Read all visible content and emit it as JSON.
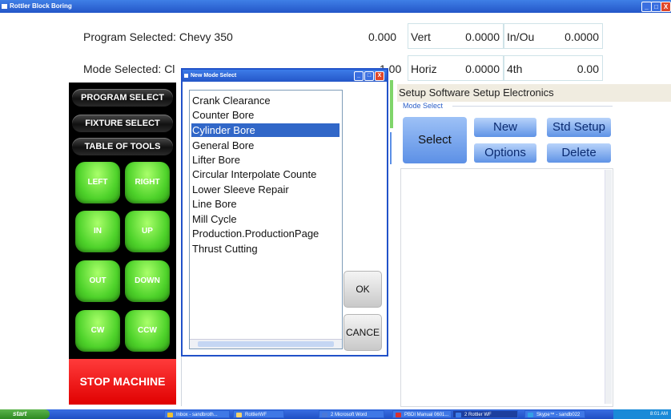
{
  "window": {
    "title": "Rottler Block Boring",
    "min_label": "_",
    "max_label": "□",
    "close_label": "X"
  },
  "header": {
    "program_selected_label": "Program Selected:",
    "program_selected_value": "Chevy 350",
    "mode_selected_label": "Mode Selected:",
    "mode_selected_value": "Cl",
    "readouts": [
      {
        "value": "0.000",
        "axis": "Vert",
        "axis_value": "0.0000",
        "axis2": "In/Ou",
        "axis2_value": "0.0000"
      },
      {
        "value": "1.00",
        "axis": "Horiz",
        "axis_value": "0.0000",
        "axis2": "4th",
        "axis2_value": "0.00"
      }
    ]
  },
  "left_panel": {
    "program_select": "PROGRAM SELECT",
    "fixture_select": "FIXTURE SELECT",
    "table_of_tools": "TABLE OF TOOLS",
    "jog_buttons": [
      "LEFT",
      "RIGHT",
      "IN",
      "UP",
      "OUT",
      "DOWN",
      "CW",
      "CCW"
    ],
    "stop": "STOP MACHINE",
    "colors": {
      "jog": "#4fd32b",
      "stop": "#e00000"
    }
  },
  "right_panel": {
    "tabs_text": "Setup Software  Setup Electronics",
    "mode_select_label": "Mode Select",
    "select": "Select",
    "new": "New",
    "std_setup": "Std Setup",
    "options": "Options",
    "delete": "Delete"
  },
  "dialog": {
    "title": "New Mode Select",
    "min_label": "_",
    "max_label": "□",
    "close_label": "X",
    "items": [
      "Crank Clearance",
      "Counter Bore",
      "Cylinder Bore",
      "General Bore",
      "Lifter Bore",
      "Circular Interpolate Counte",
      "Lower Sleeve Repair",
      "Line Bore",
      "Mill Cycle",
      "Production.ProductionPage",
      "Thrust Cutting"
    ],
    "selected_index": 2,
    "ok": "OK",
    "cancel": "CANCE",
    "accent": "#2152c9"
  },
  "taskbar": {
    "start": "start",
    "items": [
      {
        "label": "Inbox - sandbroth...",
        "icon": "#f0c030"
      },
      {
        "label": "RottlerWF",
        "icon": "#f7d26b"
      },
      {
        "label": "2 Microsoft Word",
        "icon": "#4a78d8"
      },
      {
        "label": "PBDI Manual 0601...",
        "icon": "#d83030"
      },
      {
        "label": "2 Rottler WF",
        "icon": "#3d7ce8",
        "active": true
      },
      {
        "label": "Skype™ - sandb022",
        "icon": "#34a0e8"
      }
    ],
    "clock": "8:01 AM"
  }
}
